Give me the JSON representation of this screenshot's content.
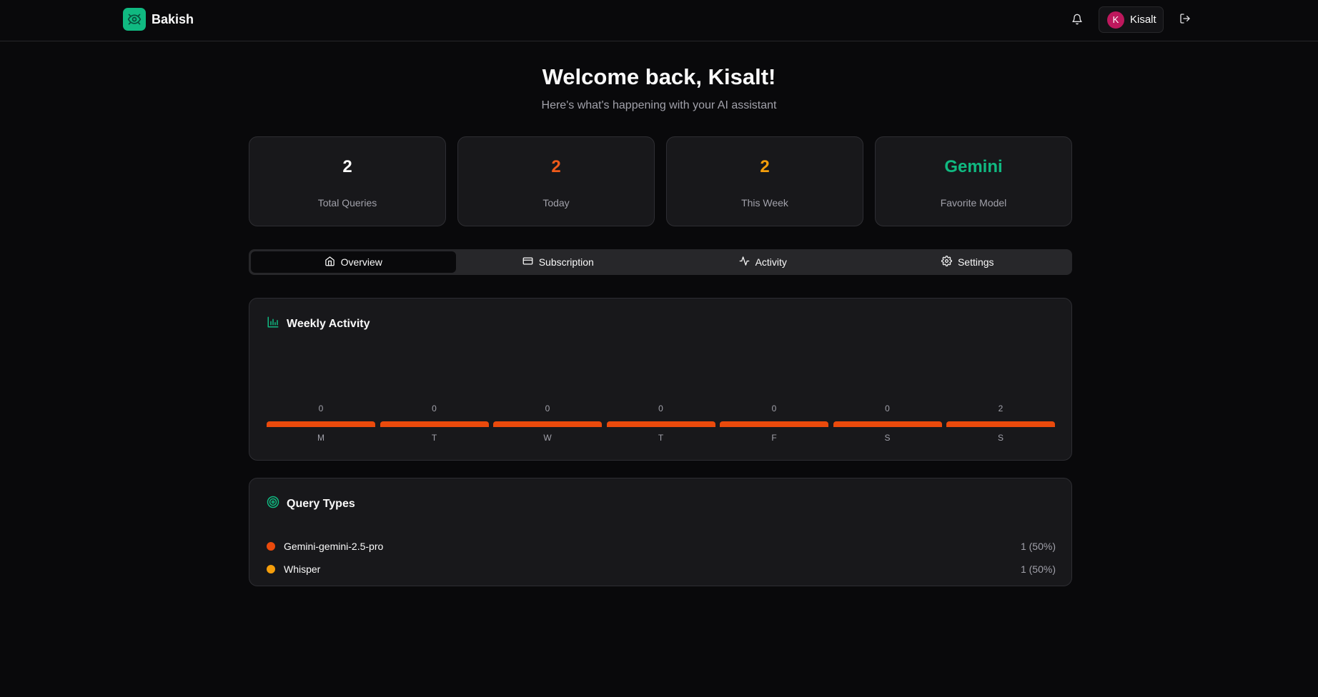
{
  "brand": {
    "name": "Bakish",
    "color": "#10b981",
    "icon": "eye-icon"
  },
  "header": {
    "notifications_icon": "bell-icon",
    "user": {
      "initial": "K",
      "name": "Kisalt",
      "avatar_color": "#be185d"
    },
    "logout_icon": "log-out-icon"
  },
  "hero": {
    "title": "Welcome back, Kisalt!",
    "subtitle": "Here's what's happening with your AI assistant"
  },
  "stats": [
    {
      "value": "2",
      "label": "Total Queries",
      "color": "#fafafa"
    },
    {
      "value": "2",
      "label": "Today",
      "color": "#f05a1a"
    },
    {
      "value": "2",
      "label": "This Week",
      "color": "#f59e0b"
    },
    {
      "value": "Gemini",
      "label": "Favorite Model",
      "color": "#10b981"
    }
  ],
  "tabs": [
    {
      "label": "Overview",
      "icon": "home-icon",
      "active": true
    },
    {
      "label": "Subscription",
      "icon": "credit-card-icon",
      "active": false
    },
    {
      "label": "Activity",
      "icon": "activity-icon",
      "active": false
    },
    {
      "label": "Settings",
      "icon": "gear-icon",
      "active": false
    }
  ],
  "weekly_activity": {
    "title": "Weekly Activity",
    "icon": "bar-chart-icon"
  },
  "chart_data": {
    "type": "bar",
    "categories": [
      "M",
      "T",
      "W",
      "T",
      "F",
      "S",
      "S"
    ],
    "values": [
      0,
      0,
      0,
      0,
      0,
      0,
      2
    ],
    "bar_color": "#ea4a0c"
  },
  "query_types": {
    "title": "Query Types",
    "icon": "target-icon",
    "items": [
      {
        "name": "Gemini-gemini-2.5-pro",
        "value": "1 (50%)",
        "color": "#ea4a0c"
      },
      {
        "name": "Whisper",
        "value": "1 (50%)",
        "color": "#f59e0b"
      }
    ]
  }
}
